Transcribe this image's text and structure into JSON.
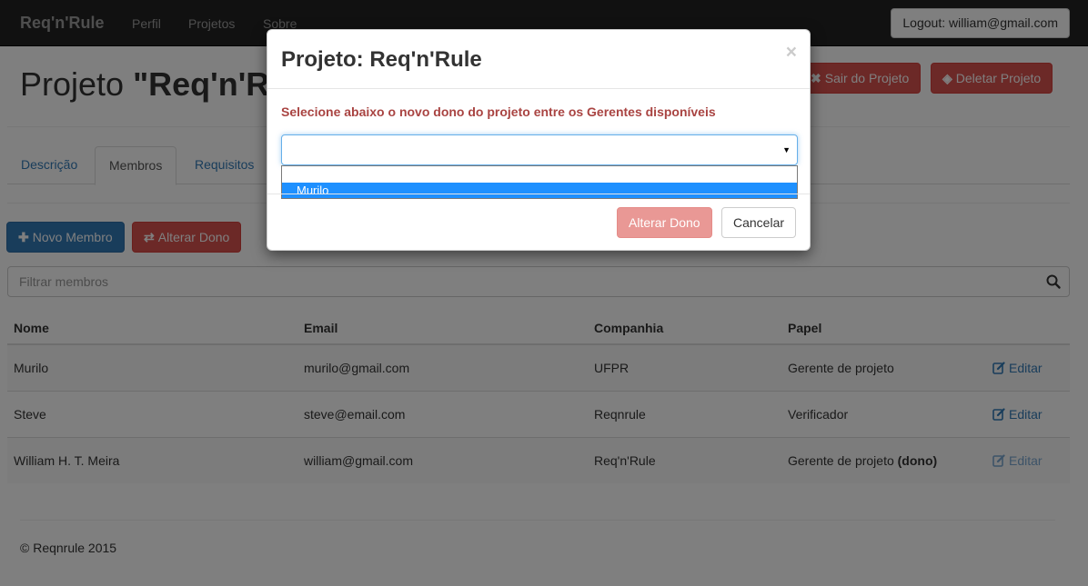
{
  "navbar": {
    "brand": "Req'n'Rule",
    "links": [
      "Perfil",
      "Projetos",
      "Sobre"
    ],
    "logout_label": "Logout: william@gmail.com"
  },
  "header": {
    "title_prefix": "Projeto ",
    "title_name": "\"Req'n'Rule\"",
    "leave_label": "Sair do Projeto",
    "delete_label": "Deletar Projeto"
  },
  "tabs": [
    "Descrição",
    "Membros",
    "Requisitos"
  ],
  "actions": {
    "new_member_label": "Novo Membro",
    "change_owner_label": "Alterar Dono"
  },
  "filter": {
    "placeholder": "Filtrar membros"
  },
  "table": {
    "headers": [
      "Nome",
      "Email",
      "Companhia",
      "Papel"
    ],
    "rows": [
      {
        "name": "Murilo",
        "email": "murilo@gmail.com",
        "company": "UFPR",
        "role": "Gerente de projeto",
        "role_extra": "",
        "action": "Editar"
      },
      {
        "name": "Steve",
        "email": "steve@email.com",
        "company": "Reqnrule",
        "role": "Verificador",
        "role_extra": "",
        "action": "Editar"
      },
      {
        "name": "William H. T. Meira",
        "email": "william@gmail.com",
        "company": "Req'n'Rule",
        "role": "Gerente de projeto ",
        "role_extra": "(dono)",
        "action": "Editar"
      }
    ]
  },
  "footer": "© Reqnrule 2015",
  "modal": {
    "title_prefix": "Projeto: ",
    "title_name": "Req'n'Rule",
    "close": "×",
    "message": "Selecione abaixo o novo dono do projeto entre os Gerentes disponíveis",
    "select_value": "",
    "options": [
      "",
      "Murilo"
    ],
    "confirm_label": "Alterar Dono",
    "cancel_label": "Cancelar"
  },
  "colors": {
    "navbar": "#222222",
    "primary": "#337ab7",
    "danger": "#d9534f",
    "error_text": "#a94442",
    "highlight": "#1e90ff"
  }
}
